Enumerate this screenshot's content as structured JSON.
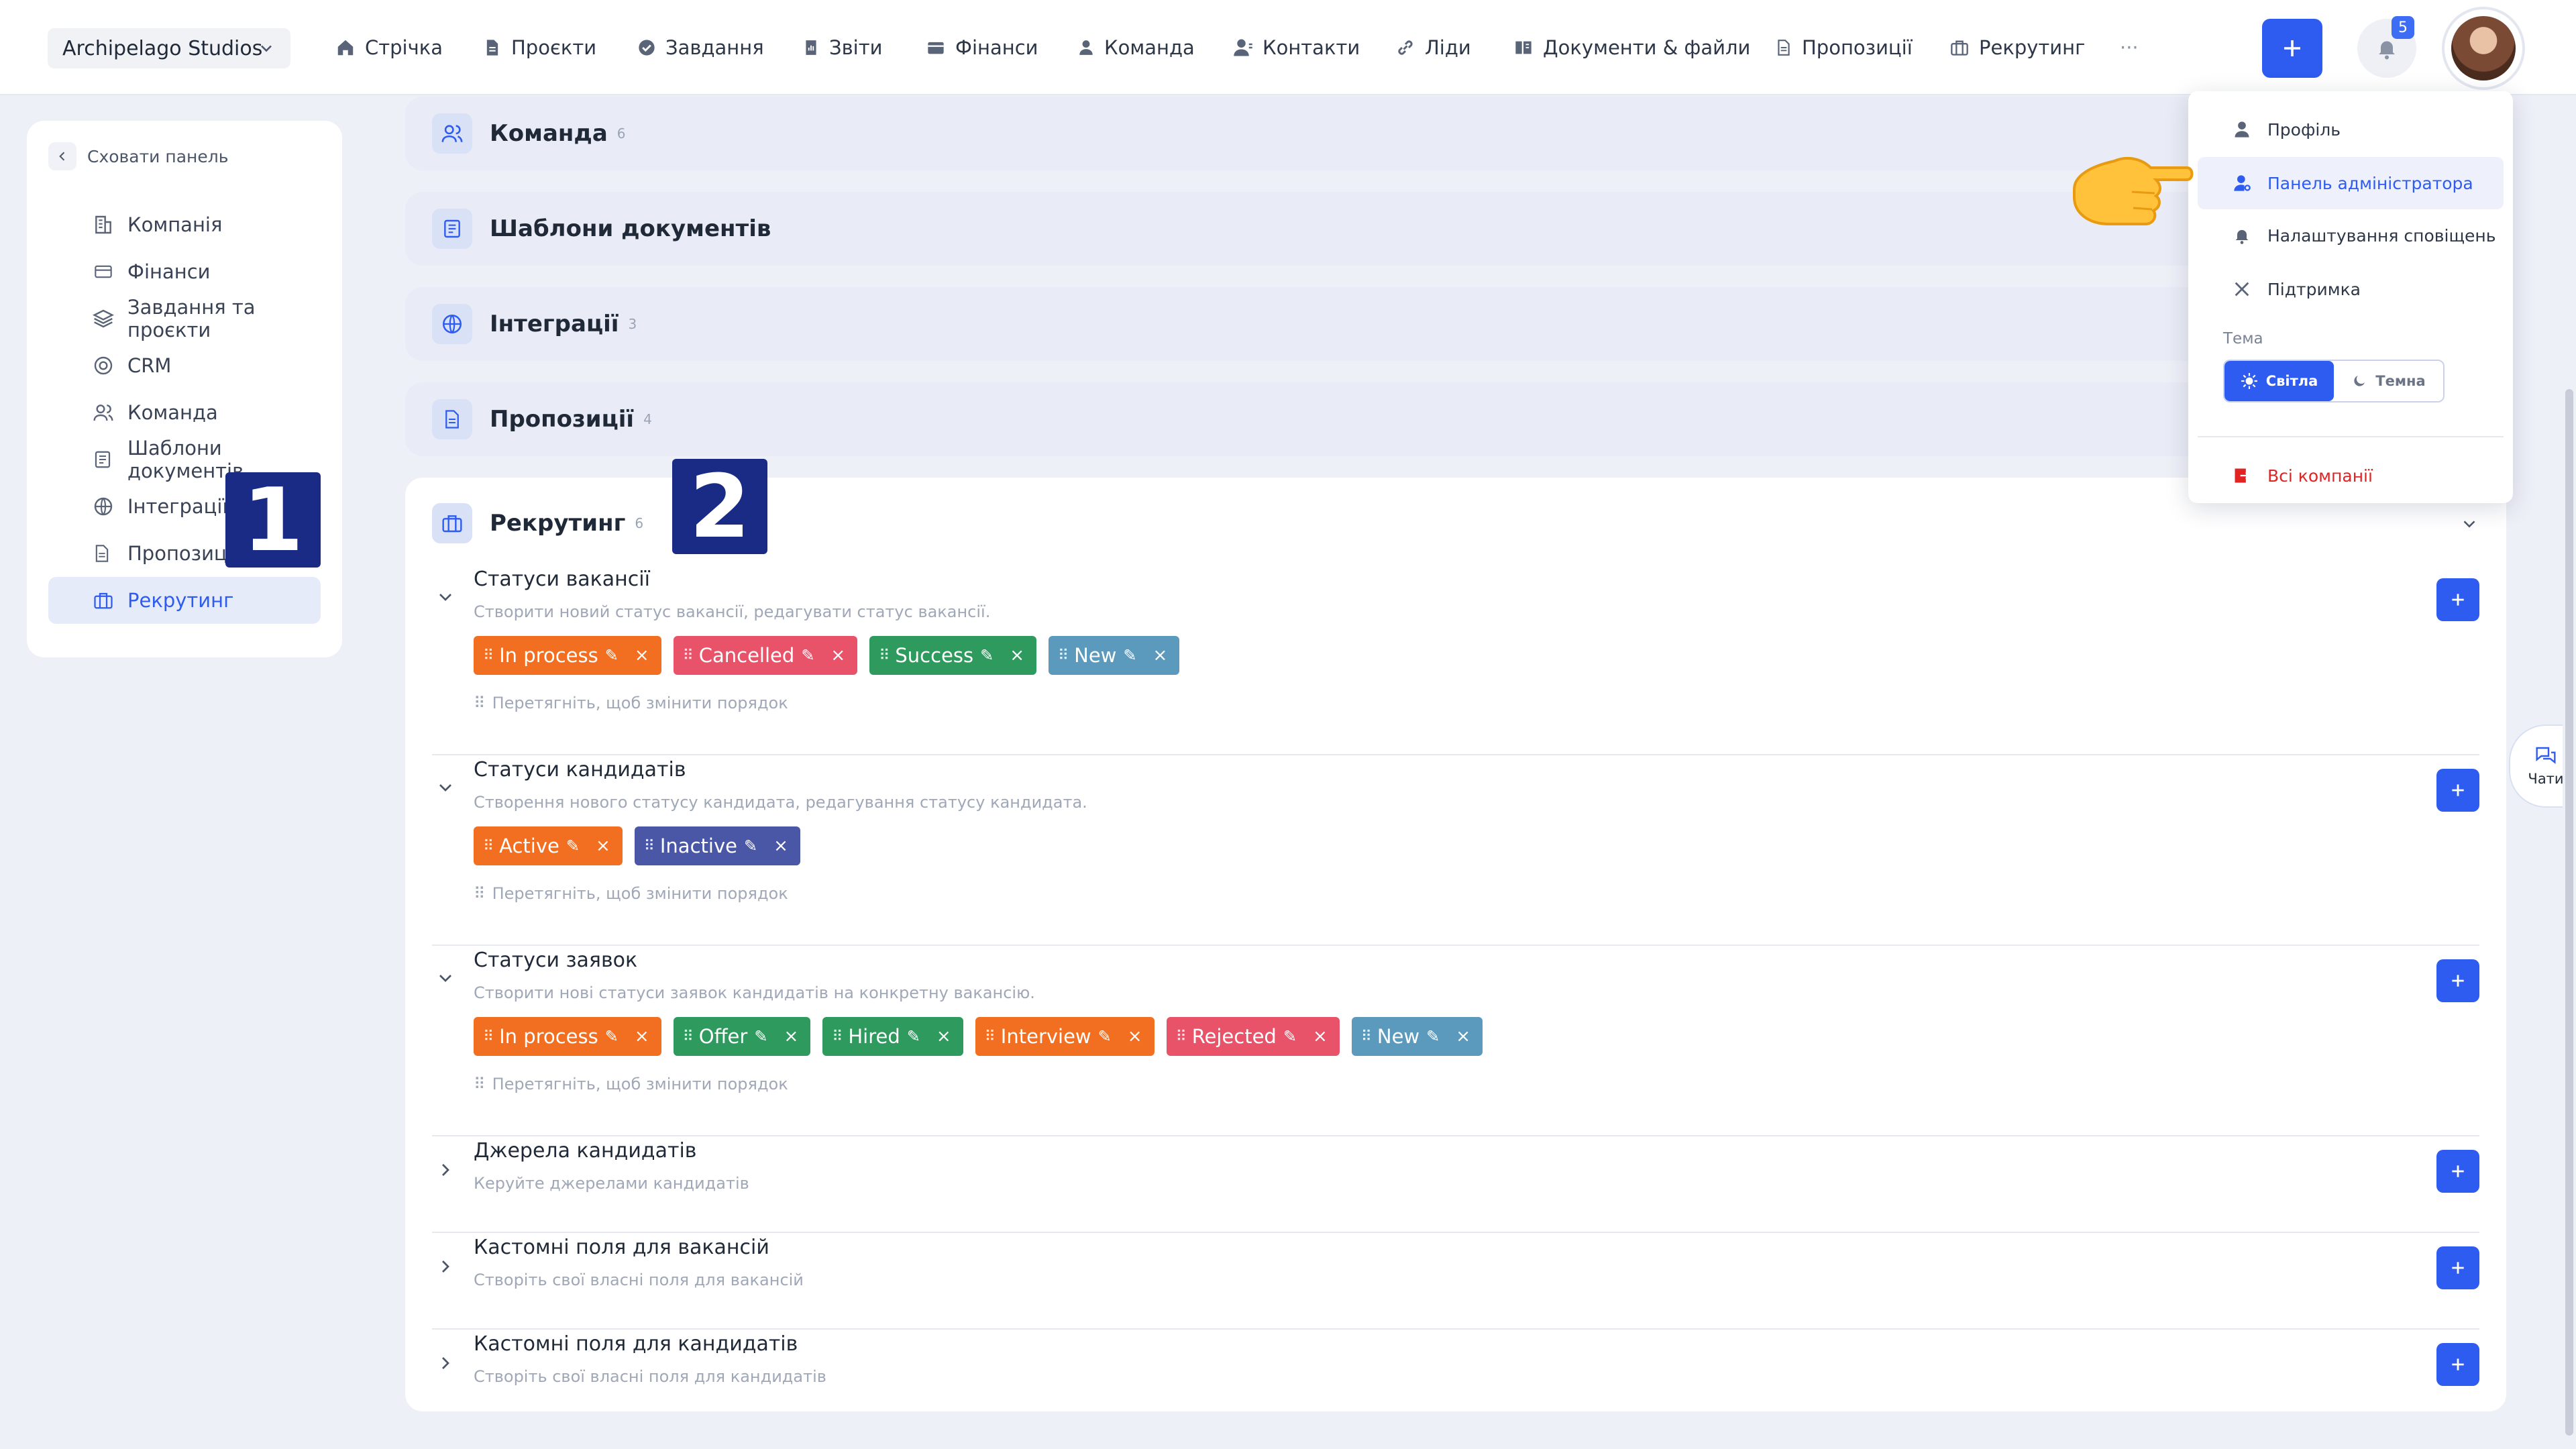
{
  "topbar": {
    "company": "Archipelago Studios",
    "nav": [
      {
        "label": "Стрічка",
        "icon": "home-icon"
      },
      {
        "label": "Проєкти",
        "icon": "document-icon"
      },
      {
        "label": "Завдання",
        "icon": "check-circle-icon"
      },
      {
        "label": "Звіти",
        "icon": "report-icon"
      },
      {
        "label": "Фінанси",
        "icon": "wallet-icon"
      },
      {
        "label": "Команда",
        "icon": "user-icon"
      },
      {
        "label": "Контакти",
        "icon": "contacts-icon"
      },
      {
        "label": "Ліди",
        "icon": "link-icon"
      },
      {
        "label": "Документи & файли",
        "icon": "book-icon"
      },
      {
        "label": "Пропозиції",
        "icon": "file-icon"
      },
      {
        "label": "Рекрутинг",
        "icon": "briefcase-icon"
      }
    ],
    "more": "···",
    "notifications_count": "5"
  },
  "sidebar": {
    "hide_label": "Сховати панель",
    "items": [
      {
        "label": "Компанія",
        "icon": "company-icon"
      },
      {
        "label": "Фінанси",
        "icon": "card-icon"
      },
      {
        "label": "Завдання та проєкти",
        "icon": "layers-icon"
      },
      {
        "label": "CRM",
        "icon": "target-icon"
      },
      {
        "label": "Команда",
        "icon": "team-icon"
      },
      {
        "label": "Шаблони документів",
        "icon": "template-icon"
      },
      {
        "label": "Інтеграції",
        "icon": "globe-icon"
      },
      {
        "label": "Пропозиції",
        "icon": "file-icon"
      },
      {
        "label": "Рекрутинг",
        "icon": "briefcase-icon",
        "active": true
      }
    ]
  },
  "badges": {
    "one": "1",
    "two": "2"
  },
  "sections": [
    {
      "title": "Команда",
      "count": "6",
      "icon": "team-icon"
    },
    {
      "title": "Шаблони документів",
      "count": "",
      "icon": "template-icon"
    },
    {
      "title": "Інтеграції",
      "count": "3",
      "icon": "globe-icon"
    },
    {
      "title": "Пропозиції",
      "count": "4",
      "icon": "file-icon"
    }
  ],
  "recruiting": {
    "title": "Рекрутинг",
    "count": "6",
    "drag_hint": "Перетягніть, щоб змінити порядок",
    "subsections": [
      {
        "title": "Статуси вакансії",
        "desc": "Створити новий статус вакансії, редагувати статус вакансії.",
        "tags": [
          {
            "label": "In process",
            "color": "#f26f21"
          },
          {
            "label": "Cancelled",
            "color": "#e9536a"
          },
          {
            "label": "Success",
            "color": "#2f9a5e"
          },
          {
            "label": "New",
            "color": "#5b9abd"
          }
        ]
      },
      {
        "title": "Статуси кандидатів",
        "desc": "Створення нового статусу кандидата, редагування статусу кандидата.",
        "tags": [
          {
            "label": "Active",
            "color": "#f26f21"
          },
          {
            "label": "Inactive",
            "color": "#4a56a6"
          }
        ]
      },
      {
        "title": "Статуси заявок",
        "desc": "Створити нові статуси заявок кандидатів на конкретну вакансію.",
        "tags": [
          {
            "label": "In process",
            "color": "#f26f21"
          },
          {
            "label": "Offer",
            "color": "#2f9a5e"
          },
          {
            "label": "Hired",
            "color": "#2f9a5e"
          },
          {
            "label": "Interview",
            "color": "#f26f21"
          },
          {
            "label": "Rejected",
            "color": "#e9536a"
          },
          {
            "label": "New",
            "color": "#5b9abd"
          }
        ]
      },
      {
        "title": "Джерела кандидатів",
        "desc": "Керуйте джерелами кандидатів"
      },
      {
        "title": "Кастомні поля для вакансій",
        "desc": "Створіть свої власні поля для вакансій"
      },
      {
        "title": "Кастомні поля для кандидатів",
        "desc": "Створіть свої власні поля для кандидатів"
      }
    ]
  },
  "dropdown": {
    "items": [
      {
        "label": "Профіль",
        "icon": "user-icon"
      },
      {
        "label": "Панель адміністратора",
        "icon": "admin-icon",
        "highlighted": true
      },
      {
        "label": "Налаштування сповіщень",
        "icon": "bell-icon"
      },
      {
        "label": "Підтримка",
        "icon": "tools-icon"
      }
    ],
    "theme_label": "Тема",
    "theme_light": "Світла",
    "theme_dark": "Темна",
    "all_companies": "Всі компанії"
  },
  "chats_label": "Чати",
  "colors": {
    "accent": "#2f5cf0",
    "badge": "#1a2b86",
    "danger": "#e02424"
  }
}
